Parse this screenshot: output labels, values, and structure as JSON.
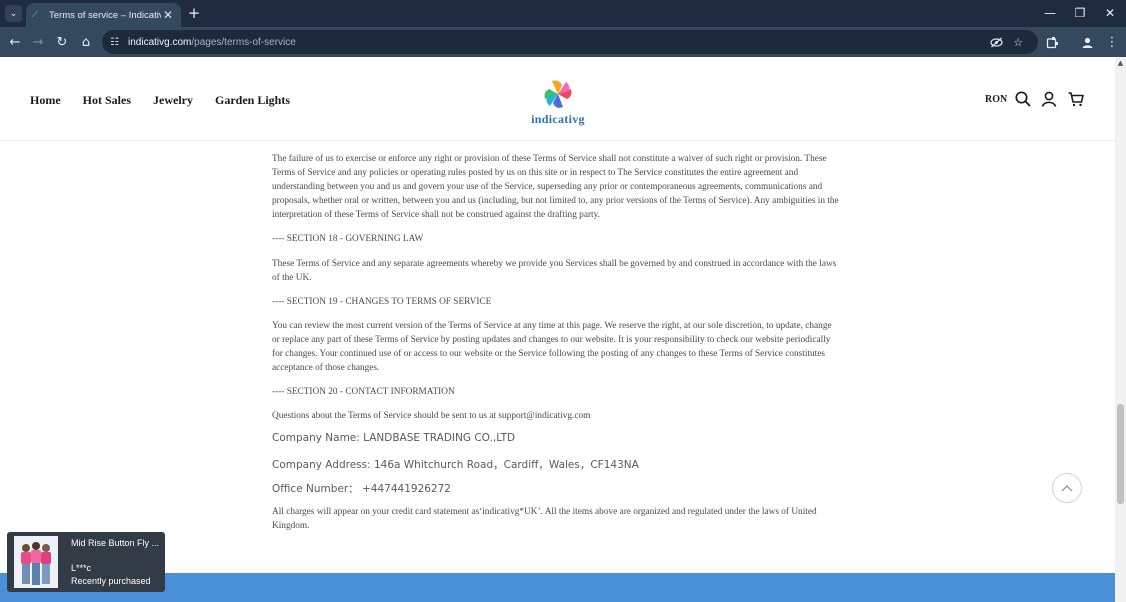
{
  "browser": {
    "tab_title": "Terms of service – Indicativg",
    "tab_close": "✕",
    "new_tab": "+",
    "url_host": "indicativg.com",
    "url_path": "/pages/terms-of-service",
    "window_minimize": "—",
    "window_restore": "❐",
    "window_close": "✕"
  },
  "site": {
    "nav": [
      "Home",
      "Hot Sales",
      "Jewelry",
      "Garden Lights"
    ],
    "logo_text": "indicativg",
    "currency": "RON",
    "accent_color": "#4a90d9"
  },
  "content": {
    "p1": "The failure of us to exercise or enforce any right or provision of these Terms of Service shall not constitute a waiver of such right or provision. These Terms of Service and any policies or operating rules posted by us on this site or in respect to The Service constitutes the entire agreement and understanding between you and us and govern your use of the Service, superseding any prior or contemporaneous agreements, communications and proposals, whether oral or written, between you and us (including, but not limited to, any prior versions of the Terms of Service). Any ambiguities in the interpretation of these Terms of Service shall not be construed against the drafting party.",
    "s18": "---- SECTION 18 - GOVERNING LAW",
    "p18": "These Terms of Service and any separate agreements whereby we provide you Services shall be governed by and construed in accordance with the laws of the UK.",
    "s19": "---- SECTION 19 - CHANGES TO TERMS OF SERVICE",
    "p19": "You can review the most current version of the Terms of Service at any time at this page. We reserve the right, at our sole discretion, to update, change or replace any part of these Terms of Service by posting updates and changes to our website. It is your responsibility to check our website periodically for changes. Your continued use of or access to our website or the Service following the posting of any changes to these Terms of Service constitutes acceptance of those changes.",
    "s20": "---- SECTION 20 - CONTACT INFORMATION",
    "p20": "Questions about the Terms of Service should be sent to us at support@indicativg.com",
    "company_name": "Company Name: LANDBASE TRADING CO.,LTD",
    "company_address": "Company Address: 146a Whitchurch Road，Cardiff，Wales，CF143NA",
    "office_number": "Office Number： +447441926272",
    "p_final": "All charges will appear on your credit card statement as‘indicativg*UK’. All the items above are organized and regulated under the laws of United Kingdom."
  },
  "popup": {
    "product": "Mid Rise Button Fly ...",
    "user": "L***c",
    "status": "Recently purchased"
  }
}
